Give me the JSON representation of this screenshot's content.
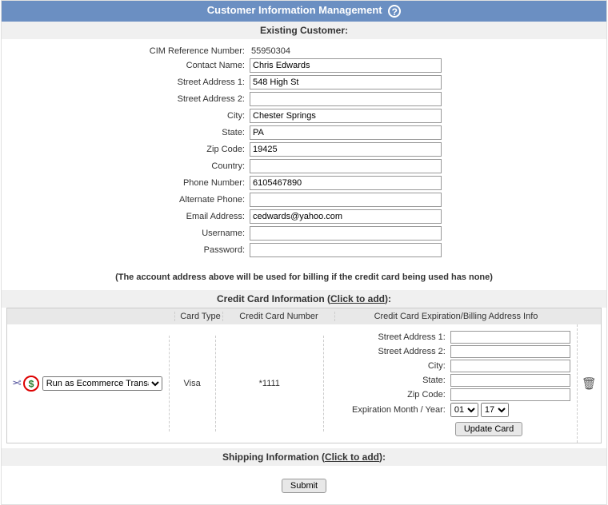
{
  "header": {
    "title": "Customer Information Management"
  },
  "existing": {
    "title": "Existing Customer:",
    "cim_label": "CIM Reference Number:",
    "cim_value": "55950304",
    "contact_label": "Contact Name:",
    "contact_value": "Chris Edwards",
    "addr1_label": "Street Address 1:",
    "addr1_value": "548 High St",
    "addr2_label": "Street Address 2:",
    "addr2_value": "",
    "city_label": "City:",
    "city_value": "Chester Springs",
    "state_label": "State:",
    "state_value": "PA",
    "zip_label": "Zip Code:",
    "zip_value": "19425",
    "country_label": "Country:",
    "country_value": "",
    "phone_label": "Phone Number:",
    "phone_value": "6105467890",
    "altphone_label": "Alternate Phone:",
    "altphone_value": "",
    "email_label": "Email Address:",
    "email_value": "cedwards@yahoo.com",
    "user_label": "Username:",
    "user_value": "",
    "pass_label": "Password:",
    "pass_value": ""
  },
  "billing_note": "(The account address above will be used for billing if the credit card being used has none)",
  "cc": {
    "heading_prefix": "Credit Card Information (",
    "heading_link": "Click to add",
    "heading_suffix": "):",
    "col_type": "Card Type",
    "col_number": "Credit Card Number",
    "col_info": "Credit Card Expiration/Billing Address Info",
    "run_as_option": "Run as Ecommerce Transaction",
    "card_type": "Visa",
    "card_number": "*1111",
    "addr1_label": "Street Address 1:",
    "addr2_label": "Street Address 2:",
    "city_label": "City:",
    "state_label": "State:",
    "zip_label": "Zip Code:",
    "exp_label": "Expiration Month / Year:",
    "exp_month": "01",
    "exp_year": "17",
    "update_btn": "Update Card"
  },
  "shipping": {
    "heading_prefix": "Shipping Information (",
    "heading_link": "Click to add",
    "heading_suffix": "):"
  },
  "submit_label": "Submit"
}
